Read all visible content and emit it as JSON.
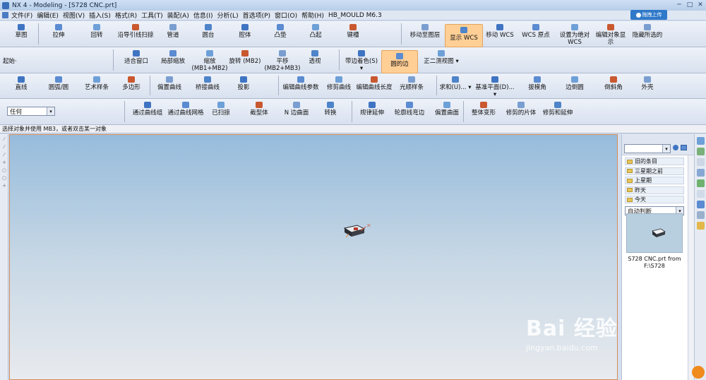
{
  "window": {
    "title": "NX 4 - Modeling - [S728 CNC.prt]",
    "min": "─",
    "max": "□",
    "close": "✕",
    "cloud_button": "拖拽上传"
  },
  "menubar": {
    "items": [
      "文件(F)",
      "编辑(E)",
      "视图(V)",
      "插入(S)",
      "格式(R)",
      "工具(T)",
      "装配(A)",
      "信息(I)",
      "分析(L)",
      "首选项(P)",
      "窗口(O)",
      "帮助(H)",
      "HB_MOULD M6.3"
    ]
  },
  "toolbar1": {
    "buttons": [
      "草图",
      "拉伸",
      "回转",
      "沿导引线扫掠",
      "管道",
      "圆台",
      "腔体",
      "凸垫",
      "凸起",
      "键槽",
      "移动至图层",
      "显示 WCS",
      "移动 WCS",
      "WCS 原点",
      "设置为绝对\nWCS",
      "编辑对象显示",
      "隐藏所选的"
    ],
    "highlighted": "显示 WCS"
  },
  "toolbar2": {
    "start_label": "起始·",
    "buttons": [
      "适合窗口",
      "局部缩放",
      "缩放\n(MB1+MB2)",
      "旋转 (MB2)",
      "平移\n(MB2+MB3)",
      "透视",
      "带边着色(S) ▾",
      "圆的边",
      "正二测视图 ▾"
    ],
    "highlighted": "圆的边"
  },
  "toolbar3": {
    "buttons": [
      "直线",
      "圆弧/圆",
      "艺术样条",
      "多边形",
      "偏置曲线",
      "桥接曲线",
      "投影",
      "编辑曲线参数",
      "修剪曲线",
      "编辑曲线长度",
      "光顺样条",
      "求和(U)... ▾",
      "基准平面(D)... ▾",
      "拔模角",
      "边倒圆",
      "倒斜角",
      "外壳"
    ]
  },
  "toolbar4": {
    "filter_value": "任何",
    "buttons": [
      "通过曲线组",
      "通过曲线网格",
      "已扫掠",
      "截型体",
      "N 边曲面",
      "转换",
      "规律延伸",
      "轮廓线弯边",
      "偏置曲面",
      "整体变形",
      "修剪的片体",
      "修剪和延伸"
    ]
  },
  "status": {
    "prompt": "选择对象并使用 MB3，或者双击某一对象"
  },
  "right_panel": {
    "folders": [
      "旧的条目",
      "三星期之前",
      "上星期",
      "昨天",
      "今天"
    ],
    "auto_select": "自动判断",
    "preview_caption": "S728 CNC.prt from\nF:\\S728"
  },
  "watermark": {
    "brand": "Bai 经验",
    "url": "jingyan.baidu.com"
  },
  "colors": {
    "highlight": "#ffcf96",
    "viewport_top": "#97bcdc",
    "viewport_bottom": "#e8eaee",
    "icon_blue": "#3f74c2"
  }
}
